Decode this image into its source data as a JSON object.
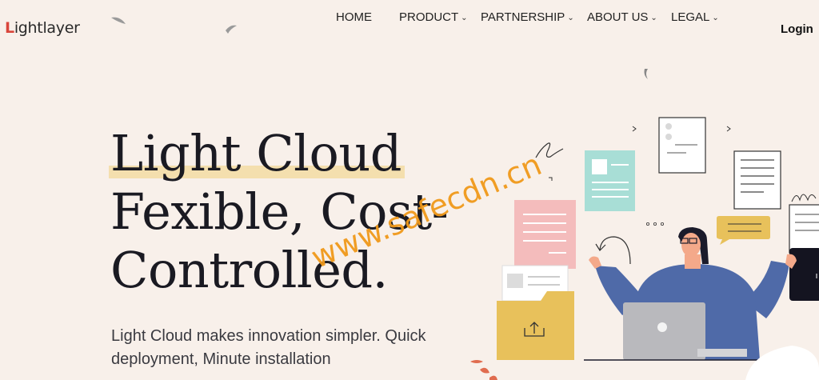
{
  "brand": {
    "logo_first": "L",
    "logo_rest": "ightlayer"
  },
  "nav": {
    "items": [
      {
        "label": "HOME",
        "has_dropdown": false
      },
      {
        "label": "PRODUCT",
        "has_dropdown": true
      },
      {
        "label": "PARTNERSHIP",
        "has_dropdown": true
      },
      {
        "label": "ABOUT US",
        "has_dropdown": true
      },
      {
        "label": "LEGAL",
        "has_dropdown": true
      }
    ],
    "login_label": "Login"
  },
  "hero": {
    "title_line1": "Light Cloud",
    "title_line2": "Fexible, Cost-",
    "title_line3": "Controlled.",
    "subtitle": "Light Cloud makes innovation simpler. Quick deployment, Minute installation"
  },
  "watermark": "www.safecdn.cn",
  "colors": {
    "background": "#f8f0ea",
    "highlight": "#f4dfae",
    "accent_logo": "#d9453b",
    "watermark": "#f0991a",
    "person_shirt": "#4f6aa8",
    "folder": "#e8c15b",
    "card_pink": "#f4bcbc",
    "card_mint": "#a8ded6",
    "chat_bubble": "#e8c15b"
  },
  "illustration": {
    "icons": [
      "person-with-laptop-icon",
      "folder-upload-icon",
      "document-icon",
      "chat-bubble-icon"
    ]
  }
}
